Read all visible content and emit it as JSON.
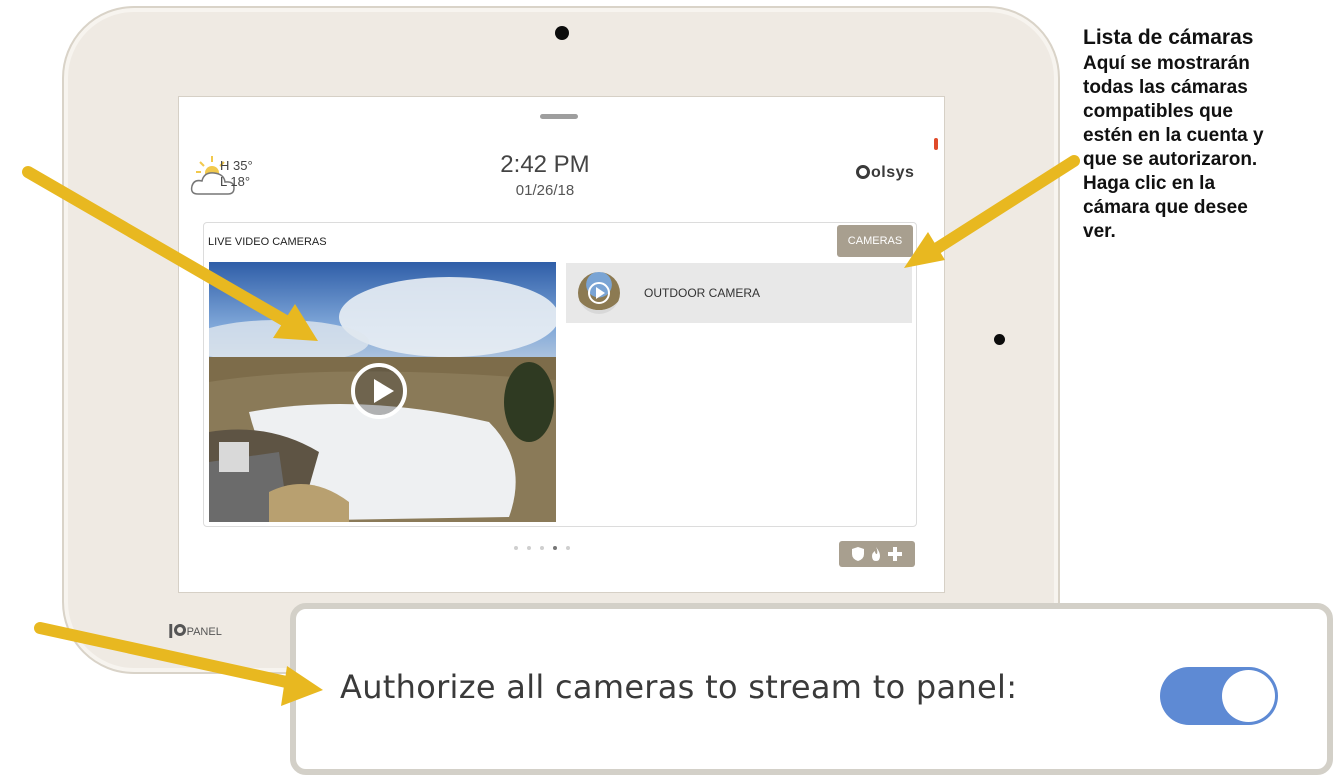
{
  "panel": {
    "weather": {
      "high": "H 35°",
      "low": "L 18°"
    },
    "time": "2:42 PM",
    "date": "01/26/18",
    "brand": "olsys",
    "card_title": "LIVE VIDEO CAMERAS",
    "cameras_button": "CAMERAS",
    "camera_list": [
      {
        "name": "OUTDOOR CAMERA"
      }
    ],
    "page_dots": {
      "count": 5,
      "active_index": 3
    },
    "emergency_icons": [
      "shield-icon",
      "fire-icon",
      "medical-cross-icon"
    ],
    "logo": {
      "iq": "IQ",
      "suffix": "PANEL"
    }
  },
  "setting": {
    "label": "Authorize all cameras to stream to panel:",
    "toggle_on": true
  },
  "annotation": {
    "title": "Lista de cámaras",
    "body_lines": [
      "Aquí se mostrarán",
      "todas las cámaras",
      "compatibles que",
      "estén en la cuenta y",
      "que se autorizaron.",
      "Haga clic en la",
      "cámara que desee",
      "ver."
    ]
  },
  "colors": {
    "arrow": "#e8b820",
    "toggle": "#5e8ad4",
    "button": "#a89f8f"
  }
}
